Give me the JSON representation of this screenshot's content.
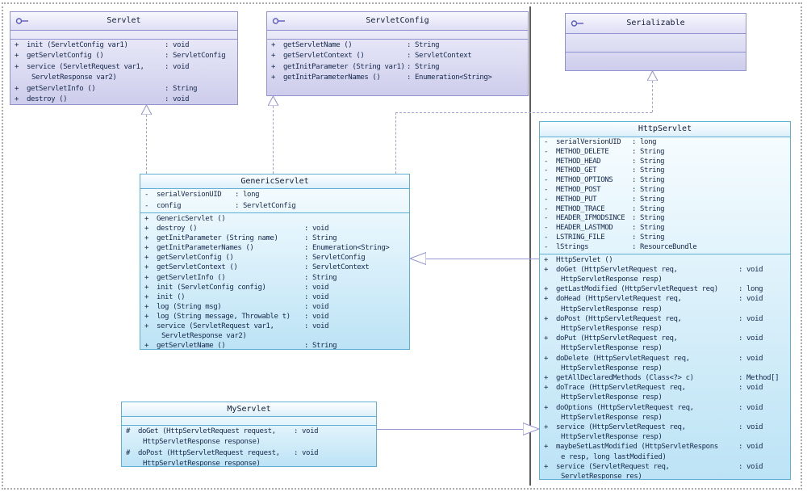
{
  "diagram": {
    "classes": [
      {
        "id": "servlet",
        "name": "Servlet",
        "stereotype": "interface",
        "attributes": [],
        "methods": [
          {
            "vis": "+",
            "lines": [
              "init (ServletConfig var1)"
            ],
            "ret": ": void"
          },
          {
            "vis": "+",
            "lines": [
              "getServletConfig ()"
            ],
            "ret": ": ServletConfig"
          },
          {
            "vis": "+",
            "lines": [
              "service (ServletRequest var1,",
              "ServletResponse var2)"
            ],
            "ret": ": void"
          },
          {
            "vis": "+",
            "lines": [
              "getServletInfo ()"
            ],
            "ret": ": String"
          },
          {
            "vis": "+",
            "lines": [
              "destroy ()"
            ],
            "ret": ": void"
          }
        ]
      },
      {
        "id": "servletconfig",
        "name": "ServletConfig",
        "stereotype": "interface",
        "attributes": [],
        "methods": [
          {
            "vis": "+",
            "lines": [
              "getServletName ()"
            ],
            "ret": ": String"
          },
          {
            "vis": "+",
            "lines": [
              "getServletContext ()"
            ],
            "ret": ": ServletContext"
          },
          {
            "vis": "+",
            "lines": [
              "getInitParameter (String var1)"
            ],
            "ret": ": String"
          },
          {
            "vis": "+",
            "lines": [
              "getInitParameterNames ()"
            ],
            "ret": ": Enumeration<String>"
          }
        ]
      },
      {
        "id": "serializable",
        "name": "Serializable",
        "stereotype": "interface",
        "attributes": [],
        "methods": []
      },
      {
        "id": "genericservlet",
        "name": "GenericServlet",
        "stereotype": "class",
        "attributes": [
          {
            "vis": "-",
            "lines": [
              "serialVersionUID"
            ],
            "ret": ": long"
          },
          {
            "vis": "-",
            "lines": [
              "config"
            ],
            "ret": ": ServletConfig"
          }
        ],
        "methods": [
          {
            "vis": "+",
            "lines": [
              "GenericServlet ()"
            ],
            "ret": ""
          },
          {
            "vis": "+",
            "lines": [
              "destroy ()"
            ],
            "ret": ": void"
          },
          {
            "vis": "+",
            "lines": [
              "getInitParameter (String name)"
            ],
            "ret": ": String"
          },
          {
            "vis": "+",
            "lines": [
              "getInitParameterNames ()"
            ],
            "ret": ": Enumeration<String>"
          },
          {
            "vis": "+",
            "lines": [
              "getServletConfig ()"
            ],
            "ret": ": ServletConfig"
          },
          {
            "vis": "+",
            "lines": [
              "getServletContext ()"
            ],
            "ret": ": ServletContext"
          },
          {
            "vis": "+",
            "lines": [
              "getServletInfo ()"
            ],
            "ret": ": String"
          },
          {
            "vis": "+",
            "lines": [
              "init (ServletConfig config)"
            ],
            "ret": ": void"
          },
          {
            "vis": "+",
            "lines": [
              "init ()"
            ],
            "ret": ": void"
          },
          {
            "vis": "+",
            "lines": [
              "log (String msg)"
            ],
            "ret": ": void"
          },
          {
            "vis": "+",
            "lines": [
              "log (String message, Throwable t)"
            ],
            "ret": ": void"
          },
          {
            "vis": "+",
            "lines": [
              "service (ServletRequest var1,",
              "ServletResponse var2)"
            ],
            "ret": ": void"
          },
          {
            "vis": "+",
            "lines": [
              "getServletName ()"
            ],
            "ret": ": String"
          }
        ]
      },
      {
        "id": "httpservlet",
        "name": "HttpServlet",
        "stereotype": "class",
        "attributes": [
          {
            "vis": "-",
            "lines": [
              "serialVersionUID"
            ],
            "ret": ": long"
          },
          {
            "vis": "-",
            "lines": [
              "METHOD_DELETE"
            ],
            "ret": ": String"
          },
          {
            "vis": "-",
            "lines": [
              "METHOD_HEAD"
            ],
            "ret": ": String"
          },
          {
            "vis": "-",
            "lines": [
              "METHOD_GET"
            ],
            "ret": ": String"
          },
          {
            "vis": "-",
            "lines": [
              "METHOD_OPTIONS"
            ],
            "ret": ": String"
          },
          {
            "vis": "-",
            "lines": [
              "METHOD_POST"
            ],
            "ret": ": String"
          },
          {
            "vis": "-",
            "lines": [
              "METHOD_PUT"
            ],
            "ret": ": String"
          },
          {
            "vis": "-",
            "lines": [
              "METHOD_TRACE"
            ],
            "ret": ": String"
          },
          {
            "vis": "-",
            "lines": [
              "HEADER_IFMODSINCE"
            ],
            "ret": ": String"
          },
          {
            "vis": "-",
            "lines": [
              "HEADER_LASTMOD"
            ],
            "ret": ": String"
          },
          {
            "vis": "-",
            "lines": [
              "LSTRING_FILE"
            ],
            "ret": ": String"
          },
          {
            "vis": "-",
            "lines": [
              "lStrings"
            ],
            "ret": ": ResourceBundle"
          }
        ],
        "methods": [
          {
            "vis": "+",
            "lines": [
              "HttpServlet ()"
            ],
            "ret": ""
          },
          {
            "vis": "+",
            "lines": [
              "doGet (HttpServletRequest req,",
              "HttpServletResponse resp)"
            ],
            "ret": ": void"
          },
          {
            "vis": "+",
            "lines": [
              "getLastModified (HttpServletRequest req)"
            ],
            "ret": ": long"
          },
          {
            "vis": "+",
            "lines": [
              "doHead (HttpServletRequest req,",
              "HttpServletResponse resp)"
            ],
            "ret": ": void"
          },
          {
            "vis": "+",
            "lines": [
              "doPost (HttpServletRequest req,",
              "HttpServletResponse resp)"
            ],
            "ret": ": void"
          },
          {
            "vis": "+",
            "lines": [
              "doPut (HttpServletRequest req,",
              "HttpServletResponse resp)"
            ],
            "ret": ": void"
          },
          {
            "vis": "+",
            "lines": [
              "doDelete (HttpServletRequest req,",
              "HttpServletResponse resp)"
            ],
            "ret": ": void"
          },
          {
            "vis": "+",
            "lines": [
              "getAllDeclaredMethods (Class<?> c)"
            ],
            "ret": ": Method[]"
          },
          {
            "vis": "+",
            "lines": [
              "doTrace (HttpServletRequest req,",
              "HttpServletResponse resp)"
            ],
            "ret": ": void"
          },
          {
            "vis": "+",
            "lines": [
              "doOptions (HttpServletRequest req,",
              "HttpServletResponse resp)"
            ],
            "ret": ": void"
          },
          {
            "vis": "+",
            "lines": [
              "service (HttpServletRequest req,",
              "HttpServletResponse resp)"
            ],
            "ret": ": void"
          },
          {
            "vis": "+",
            "lines": [
              "maybeSetLastModified (HttpServletRespons",
              "e resp, long lastModified)"
            ],
            "ret": ": void"
          },
          {
            "vis": "+",
            "lines": [
              "service (ServletRequest req,",
              "ServletResponse res)"
            ],
            "ret": ": void"
          }
        ]
      },
      {
        "id": "myservlet",
        "name": "MyServlet",
        "stereotype": "class",
        "attributes": [],
        "methods": [
          {
            "vis": "#",
            "lines": [
              "doGet (HttpServletRequest request,",
              "HttpServletResponse response)"
            ],
            "ret": ": void"
          },
          {
            "vis": "#",
            "lines": [
              "doPost (HttpServletRequest request,",
              "HttpServletResponse response)"
            ],
            "ret": ": void"
          }
        ]
      }
    ],
    "relations": [
      {
        "from": "GenericServlet",
        "to": "Servlet",
        "type": "realization"
      },
      {
        "from": "GenericServlet",
        "to": "ServletConfig",
        "type": "realization"
      },
      {
        "from": "GenericServlet",
        "to": "Serializable",
        "type": "realization"
      },
      {
        "from": "HttpServlet",
        "to": "GenericServlet",
        "type": "generalization"
      },
      {
        "from": "MyServlet",
        "to": "HttpServlet",
        "type": "generalization"
      }
    ],
    "colors": {
      "interface_border": "#9292cf",
      "class_border": "#5fafd5",
      "connector": "#9595d8",
      "text": "#16294d"
    }
  }
}
